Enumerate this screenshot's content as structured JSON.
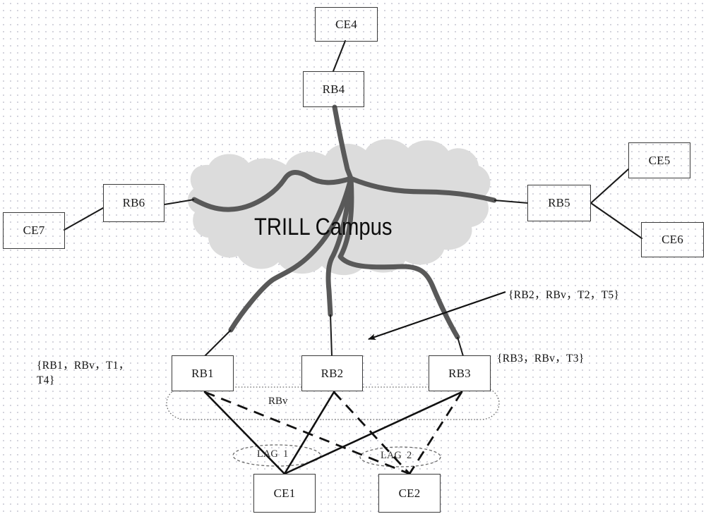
{
  "diagram": {
    "title": "TRILL Campus",
    "cloud_label": "TRILL Campus",
    "background": "#ffffff",
    "grid_dot_color": "#c9c9d4",
    "cloud_fill": "#dcdcdc",
    "trunk_color": "#595959",
    "edge_color": "#1a1a1a"
  },
  "nodes": {
    "ce4": "CE4",
    "rb4": "RB4",
    "ce5": "CE5",
    "ce6": "CE6",
    "rb5": "RB5",
    "rb6": "RB6",
    "ce7": "CE7",
    "rb1": "RB1",
    "rb2": "RB2",
    "rb3": "RB3",
    "ce1": "CE1",
    "ce2": "CE2"
  },
  "groups": {
    "rbv": "RBv",
    "lag1": "LAG  1",
    "lag2": "LAG  2"
  },
  "annotations": {
    "rb1_set": "{RB1，RBv，T1，\nT4}",
    "rb2_set": "{RB2，RBv，T2，T5}",
    "rb3_set": "{RB3，RBv，T3}"
  }
}
